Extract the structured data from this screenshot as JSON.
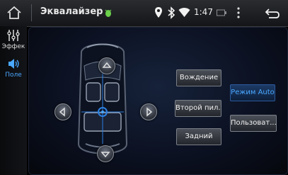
{
  "topbar": {
    "title": "Эквалайзер",
    "time": "1:47",
    "icons": [
      "home-icon",
      "android-debug-icon",
      "location-icon",
      "bluetooth-icon",
      "wifi-icon",
      "battery-icon",
      "overflow-menu-icon",
      "back-icon"
    ]
  },
  "sidebar": {
    "items": [
      {
        "label": "Эффек",
        "icon": "equalizer-sliders-icon"
      },
      {
        "label": "Поле",
        "icon": "speaker-icon"
      }
    ]
  },
  "field": {
    "buttons": {
      "driving": "Вождение",
      "second_row": "Второй пил...",
      "rear": "Задний",
      "auto_mode": "Режим Auto",
      "user": "Пользоват..."
    }
  },
  "colors": {
    "accent": "#4aa8ff",
    "panel": "#0b1020"
  }
}
